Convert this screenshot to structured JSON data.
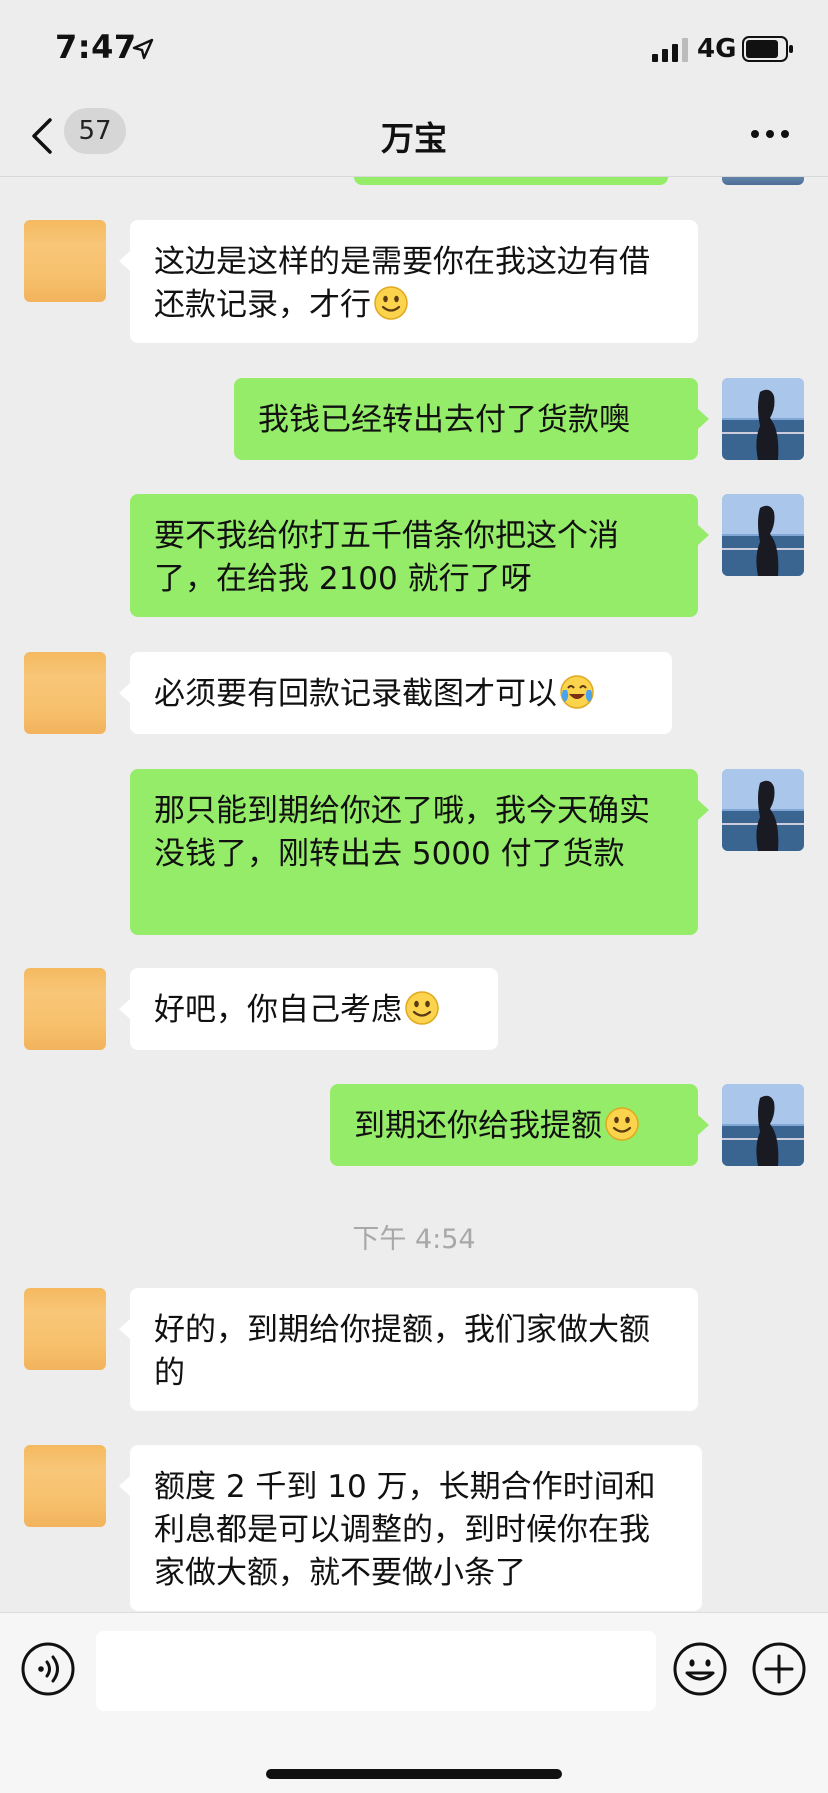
{
  "status_bar": {
    "time": "7:47",
    "network": "4G",
    "icons": [
      "location-arrow-icon",
      "signal-icon",
      "battery-icon"
    ]
  },
  "nav": {
    "back_icon": "chevron-left-icon",
    "unread_count": "57",
    "title": "万宝",
    "more_icon": "more-dots-icon"
  },
  "messages": [
    {
      "side": "left",
      "text": "这边是这样的是需要你在我这边有借还款记录，才行",
      "emoji": "smile-emoji"
    },
    {
      "side": "right",
      "text": "我钱已经转出去付了货款噢",
      "emoji": ""
    },
    {
      "side": "right",
      "text": "要不我给你打五千借条你把这个消了，在给我 2100 就行了呀",
      "emoji": ""
    },
    {
      "side": "left",
      "text": "必须要有回款记录截图才可以",
      "emoji": "laughing-crying-emoji"
    },
    {
      "side": "right",
      "text": "那只能到期给你还了哦，我今天确实没钱了，刚转出去 5000 付了货款",
      "emoji": ""
    },
    {
      "side": "left",
      "text": "好吧，你自己考虑",
      "emoji": "smile-emoji"
    },
    {
      "side": "right",
      "text": "到期还你给我提额",
      "emoji": "smile-emoji"
    },
    {
      "side": "left",
      "text": "好的，到期给你提额，我们家做大额的",
      "emoji": ""
    },
    {
      "side": "left",
      "text": "额度 2 千到 10 万，长期合作时间和利息都是可以调整的，到时候你在我家做大额，就不要做小条了",
      "emoji": ""
    }
  ],
  "timestamp": "下午 4:54",
  "input_bar": {
    "icons": [
      "voice-icon",
      "emoji-icon",
      "plus-icon"
    ],
    "input_value": ""
  },
  "colors": {
    "background": "#ededed",
    "sent_bubble": "#95ec69",
    "received_bubble": "#ffffff"
  }
}
